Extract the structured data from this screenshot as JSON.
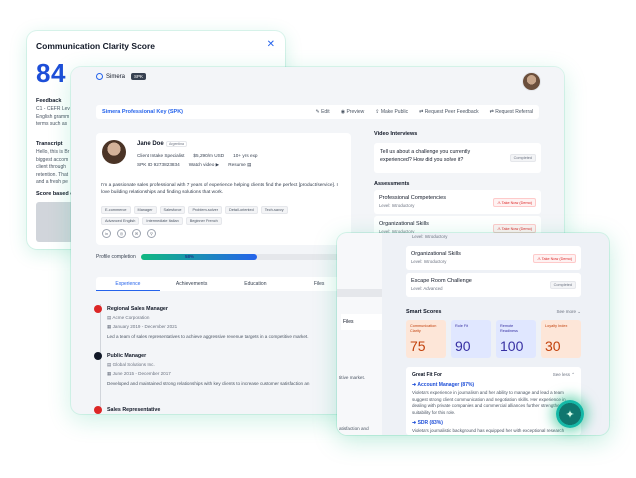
{
  "clarity": {
    "title": "Communication Clarity Score",
    "score": "84",
    "feedback_label": "Feedback",
    "feedback_lines": [
      "C1 - CEFR Lev",
      "English gramm",
      "terms such as"
    ],
    "transcript_label": "Transcript",
    "transcript_lines": [
      "Hello, this is Br",
      "biggest accom",
      "client through",
      "retention. That",
      "and a fresh pe"
    ],
    "score_based_label": "Score based o"
  },
  "app": {
    "brand": "Simera",
    "brand_badge": "SPK"
  },
  "keybar": {
    "title": "Simera Professional Key (SPK)",
    "actions": [
      "Edit",
      "Preview",
      "Make Public",
      "Request Peer Feedback",
      "Request Referral"
    ]
  },
  "profile": {
    "name": "Jane Doe",
    "country": "Argentina",
    "role": "Client Intake Specialist",
    "rate": "$5,290/m USD",
    "experience": "10+ yrs exp",
    "spk_id": "SPK ID 9273823834",
    "watch_video": "Watch video",
    "resume": "Resume",
    "about": "I'm a passionate sales professional with 7 years of experience helping clients find the perfect [product/service]. I love building relationships and finding solutions that work.",
    "tags": [
      "E-commerce",
      "Manager",
      "Salesforce",
      "Problem-solver",
      "Detail-oriented",
      "Tech-savvy",
      "Advanced English",
      "Intermediate Italian",
      "Beginner French"
    ]
  },
  "progress": {
    "label": "Profile completion",
    "value_text": "58%",
    "value": 0.58
  },
  "tabs": [
    "Experience",
    "Achievements",
    "Education",
    "Files"
  ],
  "experience": [
    {
      "title": "Regional Sales Manager",
      "company": "Acme Corporation",
      "dates": "January 2019 - December 2021",
      "desc": "Led a team of sales representatives to achieve aggressive revenue targets in a competitive market."
    },
    {
      "title": "Public Manager",
      "company": "Global Solutions Inc.",
      "dates": "June 2015 - December 2017",
      "desc": "Developed and maintained strong relationships with key clients to increase customer satisfaction an"
    },
    {
      "title": "Sales Representative"
    }
  ],
  "video_interviews": {
    "heading": "Video Interviews",
    "question": "Tell us about a challenge you currently experienced? How did you solve it?",
    "status": "Completed"
  },
  "assessments": {
    "heading": "Assessments",
    "items": [
      {
        "name": "Professional Competencies",
        "level": "Level: Introductory",
        "status": "Take Now (Demo)"
      },
      {
        "name": "Organizational Skills",
        "level": "Level: Introductory",
        "status": "Take Now (Demo)"
      }
    ]
  },
  "front": {
    "files_label": "Files",
    "frag_market": "titive market.",
    "frag_sat": "atisfaction and",
    "top_level": "Level: Introductory",
    "assessments": [
      {
        "name": "Organizational Skills",
        "level": "Level: Introductory",
        "status": "Take Now (Demo)"
      },
      {
        "name": "Escape Room Challenge",
        "level": "Level: Advanced",
        "status": "Completed"
      }
    ],
    "smart_scores": {
      "heading": "Smart Scores",
      "see_more": "See more",
      "items": [
        {
          "label": "Communication Clarity",
          "value": "75",
          "bg": "#fde6d8",
          "color": "#c2410c"
        },
        {
          "label": "Role Fit",
          "value": "90",
          "bg": "#e0e7ff",
          "color": "#3730a3"
        },
        {
          "label": "Remote Readiness",
          "value": "100",
          "bg": "#e0e7ff",
          "color": "#3730a3"
        },
        {
          "label": "Loyalty Index",
          "value": "30",
          "bg": "#fde6d8",
          "color": "#c2410c"
        }
      ]
    },
    "great_fit": {
      "heading": "Great Fit For",
      "see_less": "See less",
      "roles": [
        {
          "role": "Account Manager (87%)",
          "desc": "Violeta's experience in journalism and her ability to manage and lead a team suggest strong client communication and negotiation skills. Her experience in dealing with private companies and commercial alliances further strengthens her suitability for this role."
        },
        {
          "role": "SDR (83%)",
          "desc": "Violeta's journalistic background has equipped her with exceptional research"
        }
      ]
    }
  },
  "colors": {
    "accent": "#2563eb",
    "brand_green": "#10b981"
  }
}
